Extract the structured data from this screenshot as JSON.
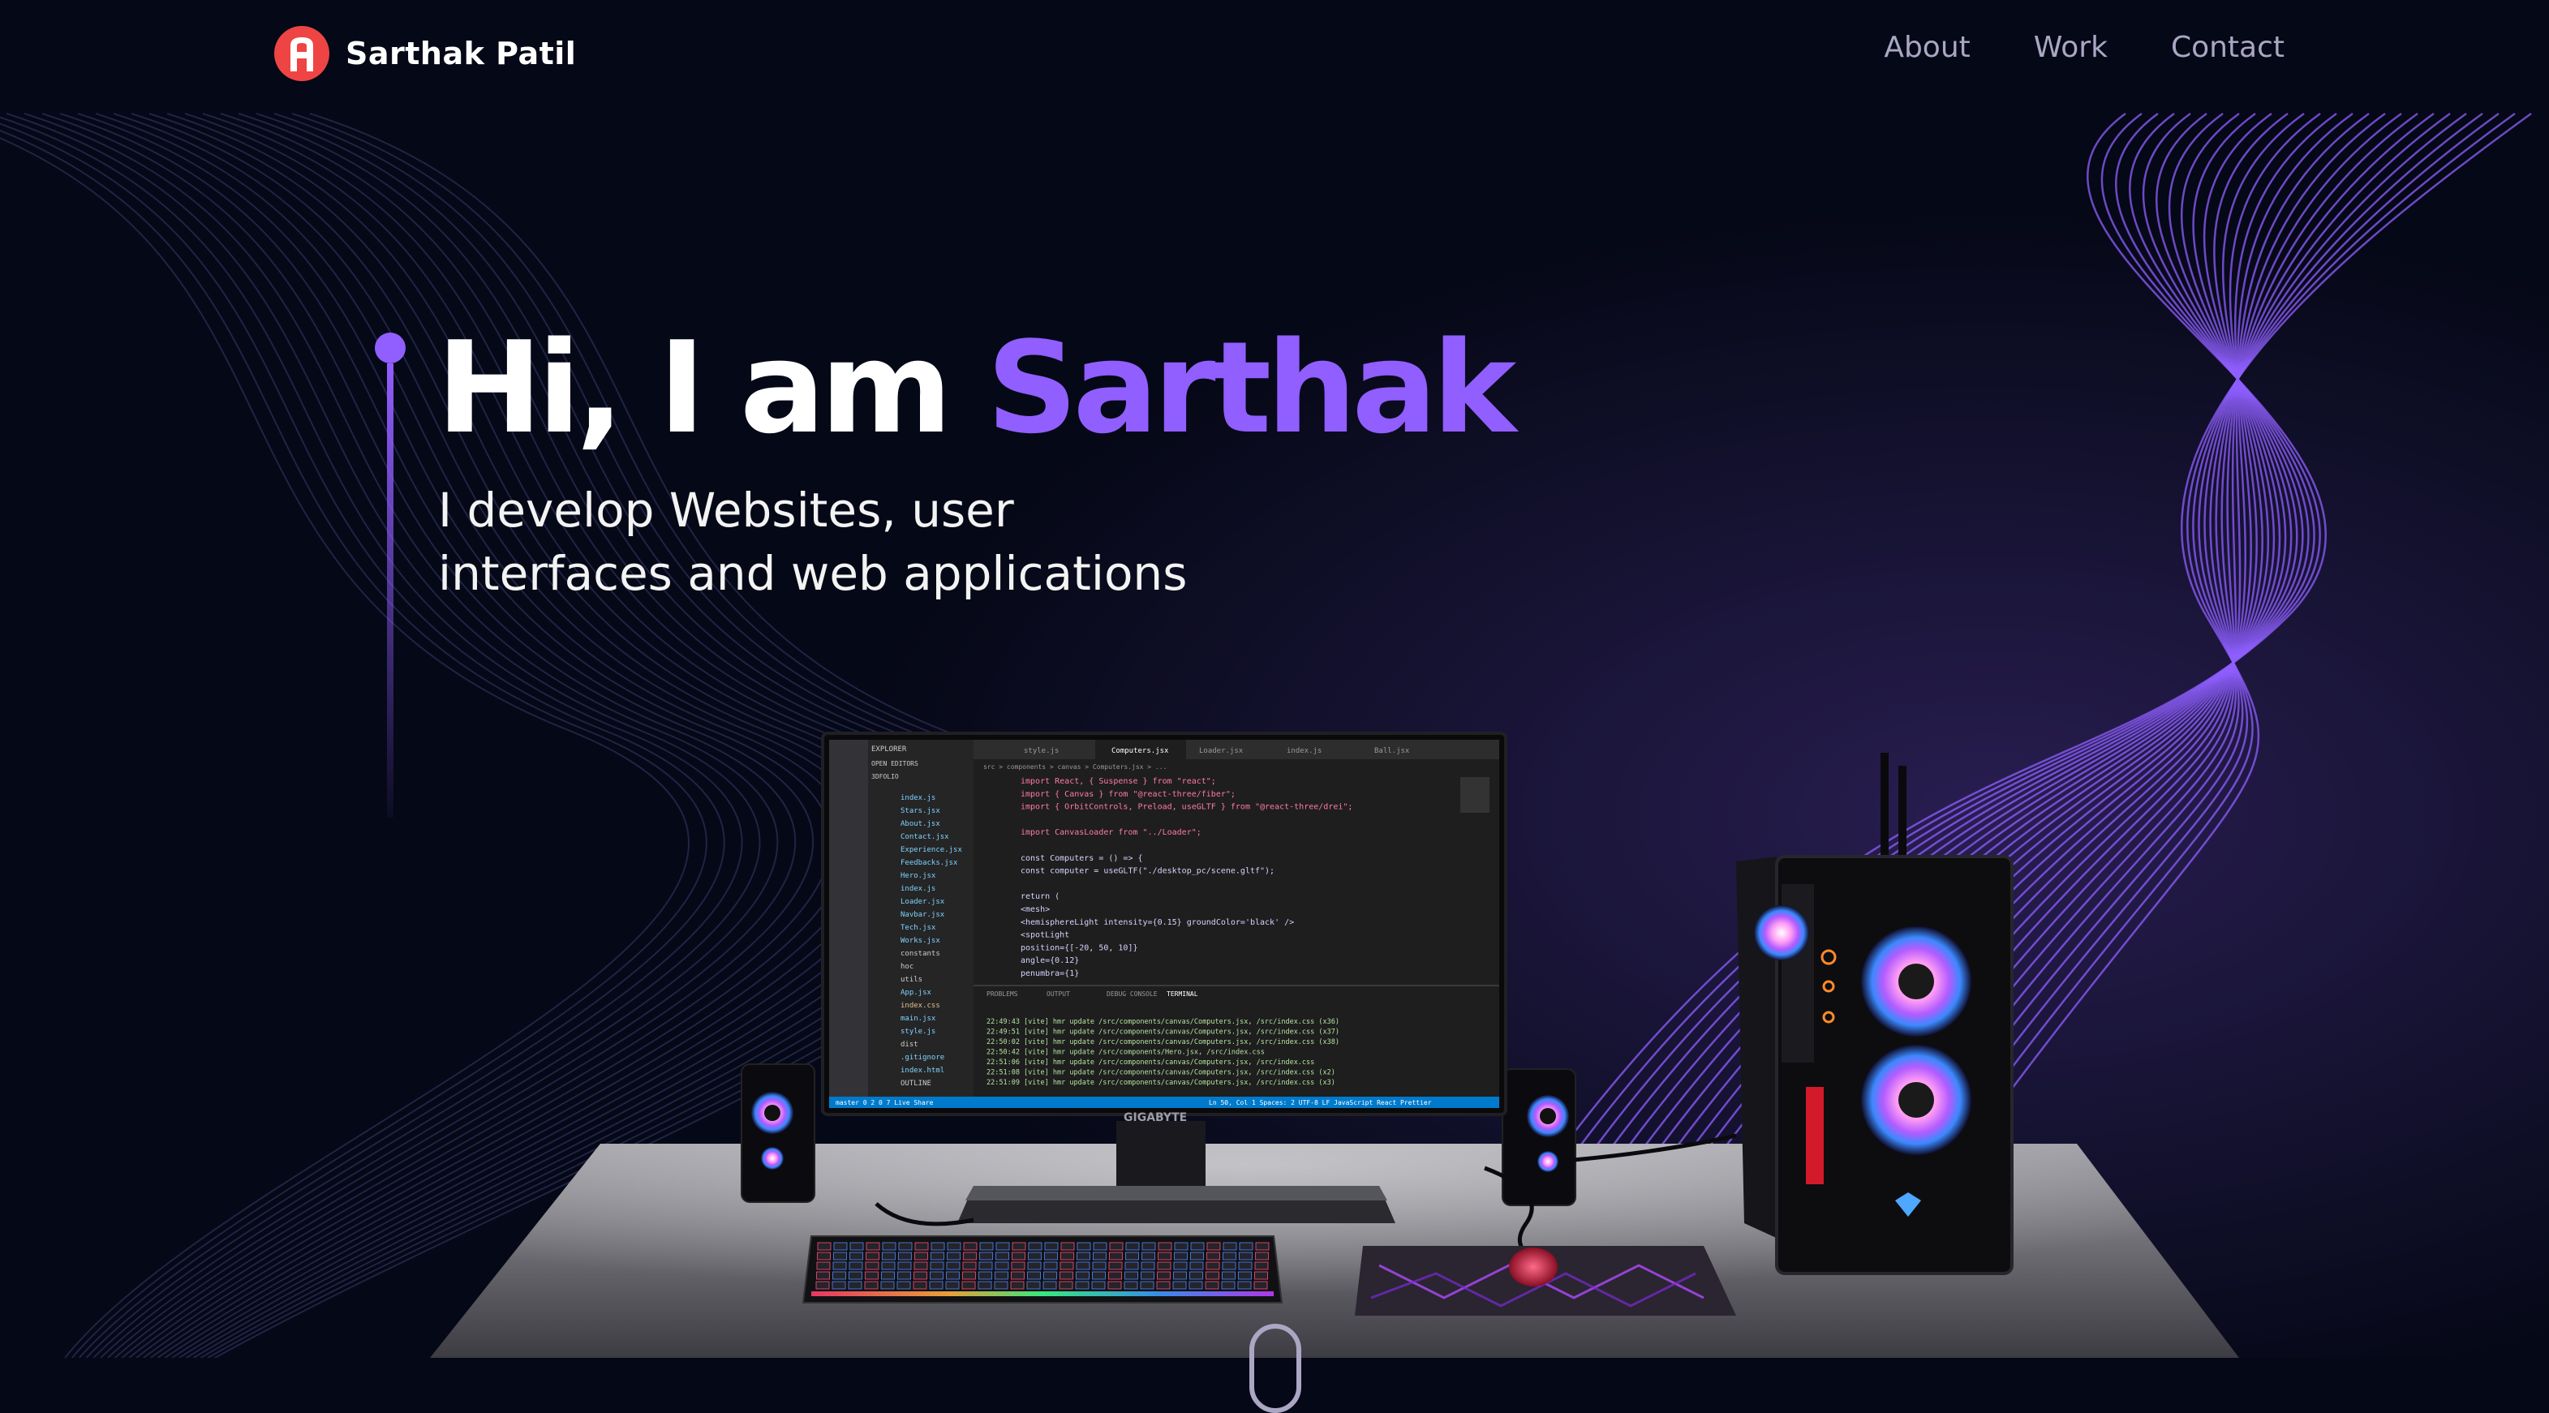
{
  "brand": {
    "name": "Sarthak Patil",
    "logo_icon": "letter-a-logo-icon"
  },
  "nav": {
    "links": [
      "About",
      "Work",
      "Contact"
    ]
  },
  "hero": {
    "greeting": "Hi, I am ",
    "name": "Sarthak",
    "subtitle_line1": "I develop Websites, user",
    "subtitle_line2": "interfaces and web applications"
  },
  "scene": {
    "monitor_brand": "GIGABYTE",
    "editor": {
      "sidebar_title": "EXPLORER",
      "open_editors": "OPEN EDITORS",
      "project": "3DFOLIO",
      "files": [
        "index.js",
        "Stars.jsx",
        "About.jsx",
        "Contact.jsx",
        "Experience.jsx",
        "Feedbacks.jsx",
        "Hero.jsx",
        "index.js",
        "Loader.jsx",
        "Navbar.jsx",
        "Tech.jsx",
        "Works.jsx",
        "constants",
        "hoc",
        "utils",
        "App.jsx",
        "index.css",
        "main.jsx",
        "style.js",
        "dist",
        ".gitignore",
        "index.html",
        "OUTLINE"
      ],
      "tabs": [
        "style.js",
        "Computers.jsx",
        "Loader.jsx",
        "index.js",
        "Ball.jsx"
      ],
      "breadcrumb": "src > components > canvas > Computers.jsx > ...",
      "code_lines": [
        "import React, { Suspense } from \"react\";",
        "import { Canvas } from \"@react-three/fiber\";",
        "import { OrbitControls, Preload, useGLTF } from \"@react-three/drei\";",
        "",
        "import CanvasLoader from \"../Loader\";",
        "",
        "const Computers = () => {",
        "  const computer = useGLTF(\"./desktop_pc/scene.gltf\");",
        "",
        "  return (",
        "    <mesh>",
        "      <hemisphereLight intensity={0.15} groundColor='black' />",
        "      <spotLight",
        "        position={[-20, 50, 10]}",
        "        angle={0.12}",
        "        penumbra={1}"
      ],
      "panel_tabs": [
        "PROBLEMS",
        "OUTPUT",
        "DEBUG CONSOLE",
        "TERMINAL"
      ],
      "terminal_lines": [
        "22:49:43 [vite] hmr update /src/components/canvas/Computers.jsx, /src/index.css (x36)",
        "22:49:51 [vite] hmr update /src/components/canvas/Computers.jsx, /src/index.css (x37)",
        "22:50:02 [vite] hmr update /src/components/canvas/Computers.jsx, /src/index.css (x38)",
        "22:50:42 [vite] hmr update /src/components/Hero.jsx, /src/index.css",
        "22:51:06 [vite] hmr update /src/components/canvas/Computers.jsx, /src/index.css",
        "22:51:08 [vite] hmr update /src/components/canvas/Computers.jsx, /src/index.css (x2)",
        "22:51:09 [vite] hmr update /src/components/canvas/Computers.jsx, /src/index.css (x3)"
      ],
      "status_left": "master  0 2  0 7  Live Share",
      "status_right": "Ln 50, Col 1  Spaces: 2  UTF-8  LF  JavaScript React  Prettier"
    }
  },
  "colors": {
    "background": "#050816",
    "accent": "#915EFF",
    "secondary": "#aaa6c3",
    "logo": "#ef4444"
  }
}
